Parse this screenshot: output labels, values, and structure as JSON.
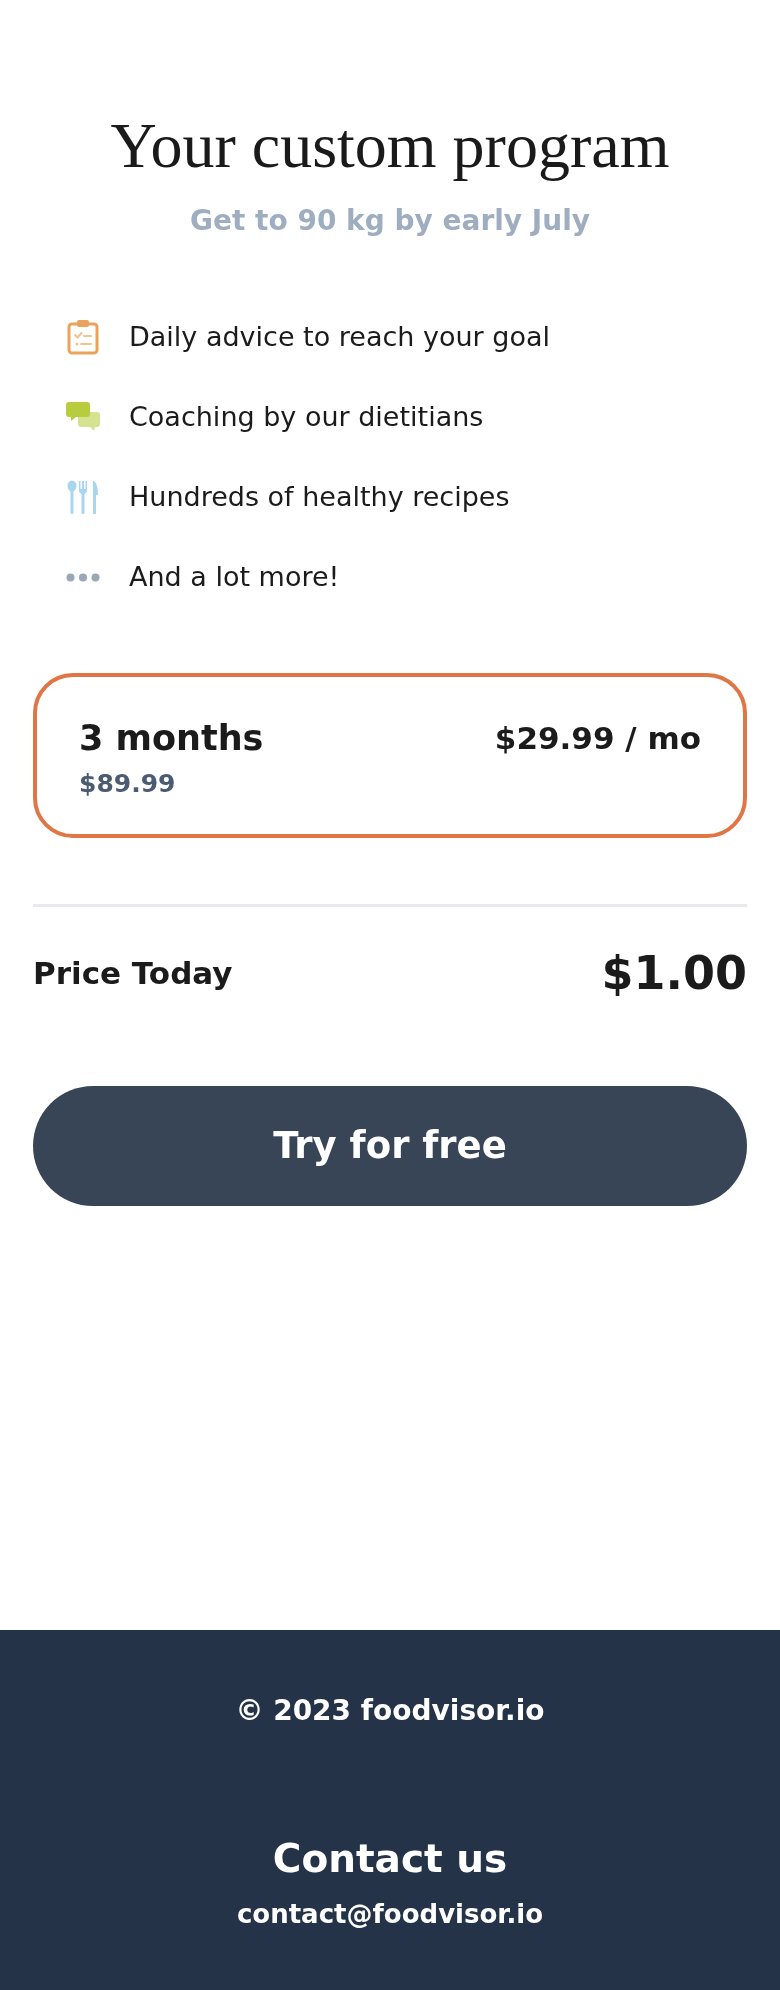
{
  "header": {
    "title": "Your custom program",
    "subtitle": "Get to 90 kg by early July"
  },
  "features": [
    {
      "kind": "clipboard",
      "text": "Daily advice to reach your goal"
    },
    {
      "kind": "chat",
      "text": "Coaching by our dietitians"
    },
    {
      "kind": "utensils",
      "text": "Hundreds of healthy recipes"
    },
    {
      "kind": "dots",
      "text": "And a lot more!"
    }
  ],
  "plan": {
    "name": "3 months",
    "total": "$89.99",
    "price": "$29.99 / mo",
    "selected": true
  },
  "price_today": {
    "label": "Price Today",
    "amount": "$1.00"
  },
  "cta": {
    "label": "Try for free"
  },
  "footer": {
    "copyright": "© 2023 foodvisor.io",
    "contact_heading": "Contact us",
    "email": "contact@foodvisor.io"
  }
}
